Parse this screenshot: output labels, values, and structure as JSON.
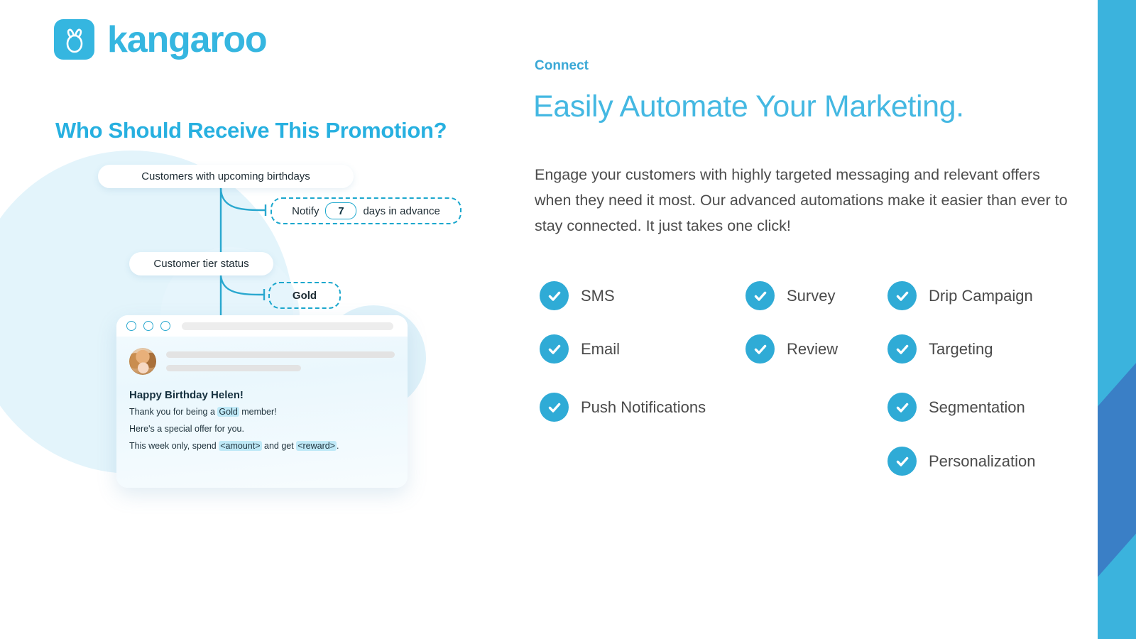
{
  "brand": {
    "name": "kangaroo",
    "logo_icon": "kangaroo-logo-icon",
    "accent": "#35b6e0",
    "ribbon_light": "#3bb3dd",
    "ribbon_dark": "#3a7fc6"
  },
  "left_panel": {
    "heading": "Who Should Receive This Promotion?",
    "flow": {
      "condition_1": "Customers with upcoming birthdays",
      "rule_1": {
        "prefix": "Notify",
        "value": "7",
        "suffix": "days in advance"
      },
      "condition_2": "Customer tier status",
      "rule_2": {
        "value": "Gold"
      }
    },
    "message_card": {
      "window_dots": [
        "dot-1",
        "dot-2",
        "dot-3"
      ],
      "url_placeholder": "",
      "avatar_icon": "user-avatar-photo",
      "greeting": "Happy Birthday Helen!",
      "line_1": {
        "before": "Thank you for being a ",
        "token": "Gold",
        "after": " member!"
      },
      "line_2": "Here's a special offer for you.",
      "line_3": {
        "before": "This week only, spend ",
        "token_1": "<amount>",
        "middle": " and get ",
        "token_2": "<reward>",
        "after": "."
      }
    }
  },
  "right_panel": {
    "eyebrow": "Connect",
    "title": "Easily Automate Your Marketing.",
    "body": "Engage your customers with highly targeted messaging and relevant offers when they need it most. Our advanced automations make it easier than ever to stay connected. It just takes one click!",
    "features": [
      {
        "label": "SMS",
        "icon": "check-circle-icon",
        "col": 0,
        "row": 0
      },
      {
        "label": "Email",
        "icon": "check-circle-icon",
        "col": 0,
        "row": 1
      },
      {
        "label": "Push Notifications",
        "icon": "check-circle-icon",
        "col": 0,
        "row": 2
      },
      {
        "label": "Survey",
        "icon": "check-circle-icon",
        "col": 1,
        "row": 0
      },
      {
        "label": "Review",
        "icon": "check-circle-icon",
        "col": 1,
        "row": 1
      },
      {
        "label": "Drip Campaign",
        "icon": "check-circle-icon",
        "col": 2,
        "row": 0
      },
      {
        "label": "Targeting",
        "icon": "check-circle-icon",
        "col": 2,
        "row": 1
      },
      {
        "label": "Segmentation",
        "icon": "check-circle-icon",
        "col": 2,
        "row": 2
      },
      {
        "label": "Personalization",
        "icon": "check-circle-icon",
        "col": 2,
        "row": 3
      }
    ]
  }
}
